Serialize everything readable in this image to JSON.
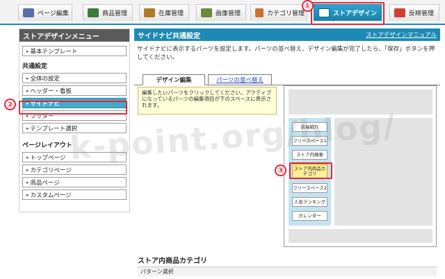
{
  "top_tabs": [
    {
      "label": "ページ編集",
      "icon": "edit-page-icon",
      "color": "#5a6fa8"
    },
    {
      "label": "商品管理",
      "icon": "pencil-icon",
      "color": "#3a7a3a"
    },
    {
      "label": "在庫管理",
      "icon": "box-icon",
      "color": "#b07a2a"
    },
    {
      "label": "画像管理",
      "icon": "image-icon",
      "color": "#6a8a3a"
    },
    {
      "label": "カテゴリ管理",
      "icon": "category-icon",
      "color": "#d07030"
    },
    {
      "label": "ストアデザイン",
      "icon": "design-icon",
      "color": "#ffffff"
    },
    {
      "label": "反映管理",
      "icon": "publish-icon",
      "color": "#d04030"
    }
  ],
  "annotations": {
    "one": "①",
    "two": "②",
    "three": "③"
  },
  "sidebar": {
    "title": "ストアデザインメニュー",
    "item_basic": "基本テンプレート",
    "common_label": "共通設定",
    "common_items": [
      "全体の設定",
      "ヘッダー・看板",
      "サイドナビ",
      "フッター",
      "テンプレート選択"
    ],
    "page_layout_label": "ページレイアウト",
    "layout_items": [
      "トップページ",
      "カテゴリページ",
      "商品ページ",
      "カスタムページ"
    ]
  },
  "main": {
    "title": "サイドナビ共通設定",
    "manual_link": "ストアデザインマニュアル",
    "description": "サイドナビに表示するパーツを設定します。パーツの並べ替え、デザイン編集が完了したら、「保存」ボタンを押してください。",
    "tab_design": "デザイン編集",
    "tab_sort": "パーツの並べ替え",
    "note": "編集したいパーツをクリックしてください。アクティブになっているパーツの編集項目が下のスペースに表示されます。",
    "parts": [
      "店長紹介",
      "フリースペース1",
      "ストア内検索",
      "ストア内商品カテゴリ",
      "フリースペース2",
      "人気ランキング",
      "カレンダー"
    ],
    "section_title": "ストア内商品カテゴリ",
    "pattern_label": "パターン選択"
  },
  "watermark": "k-point.org/blog/",
  "colors": {
    "accent": "#1c8ab4",
    "highlight": "#e4253a",
    "selected_part": "#ffef9a"
  }
}
